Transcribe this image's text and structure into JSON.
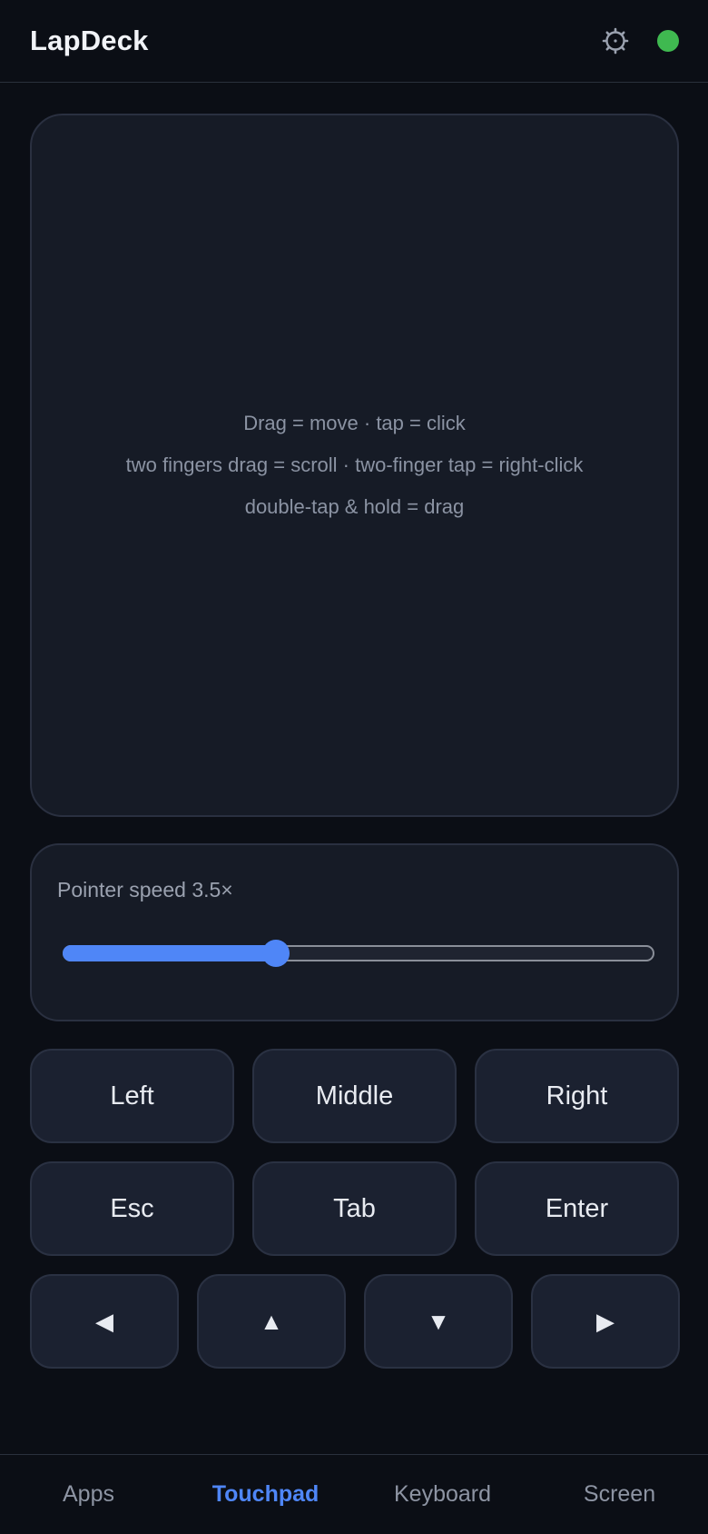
{
  "header": {
    "title": "LapDeck",
    "settings_icon": "gear-icon",
    "connection_status_color": "#3fb950"
  },
  "touchpad": {
    "hints": [
      "Drag = move · tap = click",
      "two fingers drag = scroll · two-finger tap = right-click",
      "double-tap & hold = drag"
    ]
  },
  "speed": {
    "label": "Pointer speed 3.5×",
    "value_fraction": 0.36,
    "accent": "#4f86f7"
  },
  "mouse_buttons": {
    "left": "Left",
    "middle": "Middle",
    "right": "Right"
  },
  "keys": {
    "esc": "Esc",
    "tab": "Tab",
    "enter": "Enter"
  },
  "arrows": {
    "left": "◀",
    "up": "▲",
    "down": "▼",
    "right": "▶"
  },
  "nav": {
    "tabs": [
      {
        "label": "Apps",
        "active": false
      },
      {
        "label": "Touchpad",
        "active": true
      },
      {
        "label": "Keyboard",
        "active": false
      },
      {
        "label": "Screen",
        "active": false
      }
    ]
  }
}
